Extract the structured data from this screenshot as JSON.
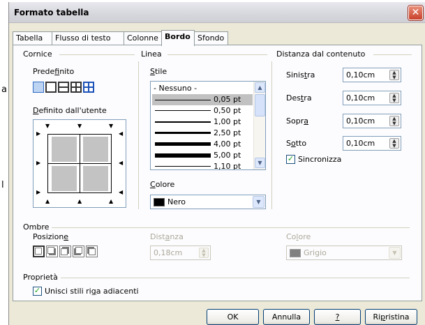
{
  "background_fragments": [
    " a",
    "l"
  ],
  "window": {
    "title": "Formato tabella",
    "close_glyph": "✕"
  },
  "tabs": [
    {
      "label": "Tabella",
      "active": false
    },
    {
      "label": "Flusso di testo",
      "active": false
    },
    {
      "label": "Colonne",
      "active": false
    },
    {
      "label": "Bordo",
      "active": true
    },
    {
      "label": "Sfondo",
      "active": false
    }
  ],
  "cornice": {
    "title": "Cornice",
    "predefinito": "Predefinito",
    "user_defined": "Definito dall'utente"
  },
  "linea": {
    "title": "Linea",
    "stile": "Stile",
    "styles": [
      "- Nessuno -",
      "0,05 pt",
      "0,50 pt",
      "1,00 pt",
      "2,50 pt",
      "4,00 pt",
      "5,00 pt",
      "1,10 pt"
    ],
    "selected_style": "0,05 pt",
    "colore_label": "Colore",
    "colore_value": "Nero",
    "colore_hex": "#000000"
  },
  "distanza": {
    "title": "Distanza dal contenuto",
    "fields": [
      {
        "label": "Sinistra",
        "value": "0,10cm"
      },
      {
        "label": "Destra",
        "value": "0,10cm"
      },
      {
        "label": "Sopra",
        "value": "0,10cm"
      },
      {
        "label": "Sotto",
        "value": "0,10cm"
      }
    ],
    "sync_label": "Sincronizza",
    "sync_checked": true
  },
  "ombre": {
    "title": "Ombre",
    "posizione": "Posizione",
    "distanza_label": "Distanza",
    "distanza_value": "0,18cm",
    "colore_label": "Colore",
    "colore_value": "Grigio",
    "colore_hex": "#808080"
  },
  "proprieta": {
    "title": "Proprietà",
    "merge_label": "Unisci stili riga adiacenti",
    "merge_checked": true
  },
  "buttons": {
    "ok": "OK",
    "annulla": "Annulla",
    "help": "?",
    "ripristina": "Ripristina"
  },
  "icons": {
    "check": "✓",
    "scroll_up": "▲",
    "scroll_down": "▼",
    "spin_up": "▲",
    "spin_down": "▼",
    "arrow_right": "▶",
    "arrow_left": "◀",
    "arrow_down": "▼",
    "arrow_up": "▲"
  }
}
